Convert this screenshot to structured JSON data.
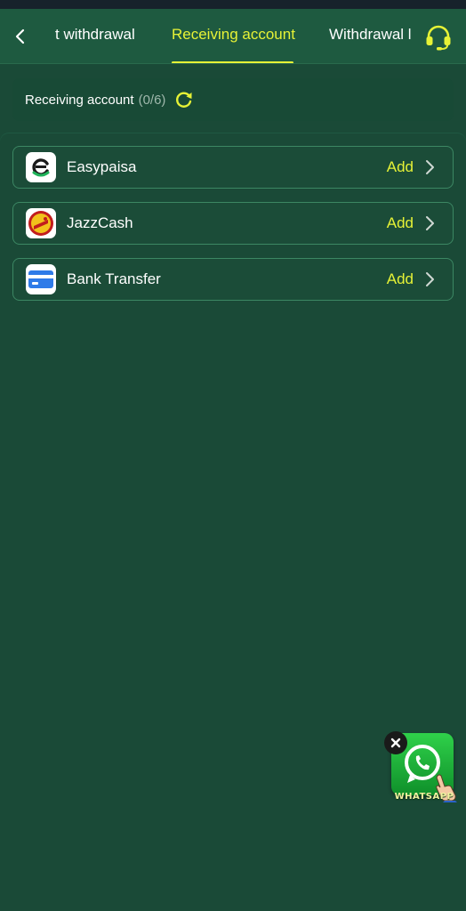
{
  "header": {
    "tabs": [
      {
        "label": "t withdrawal",
        "active": false
      },
      {
        "label": "Receiving account",
        "active": true
      },
      {
        "label": "Withdrawal l",
        "active": false
      }
    ],
    "back_icon": "chevron-left-icon",
    "support_icon": "headset-icon"
  },
  "summary": {
    "label": "Receiving account",
    "count": "(0/6)",
    "refresh_icon": "refresh-icon"
  },
  "methods": [
    {
      "name": "Easypaisa",
      "action": "Add",
      "icon": "easypaisa-logo"
    },
    {
      "name": "JazzCash",
      "action": "Add",
      "icon": "jazzcash-logo"
    },
    {
      "name": "Bank Transfer",
      "action": "Add",
      "icon": "bank-card-icon"
    }
  ],
  "whatsapp": {
    "label": "WHATSAPP",
    "close_icon": "close-icon"
  },
  "colors": {
    "accent": "#e6f236",
    "background": "#1a4a37",
    "header": "#1e5a40",
    "row_border": "#3c8763"
  }
}
